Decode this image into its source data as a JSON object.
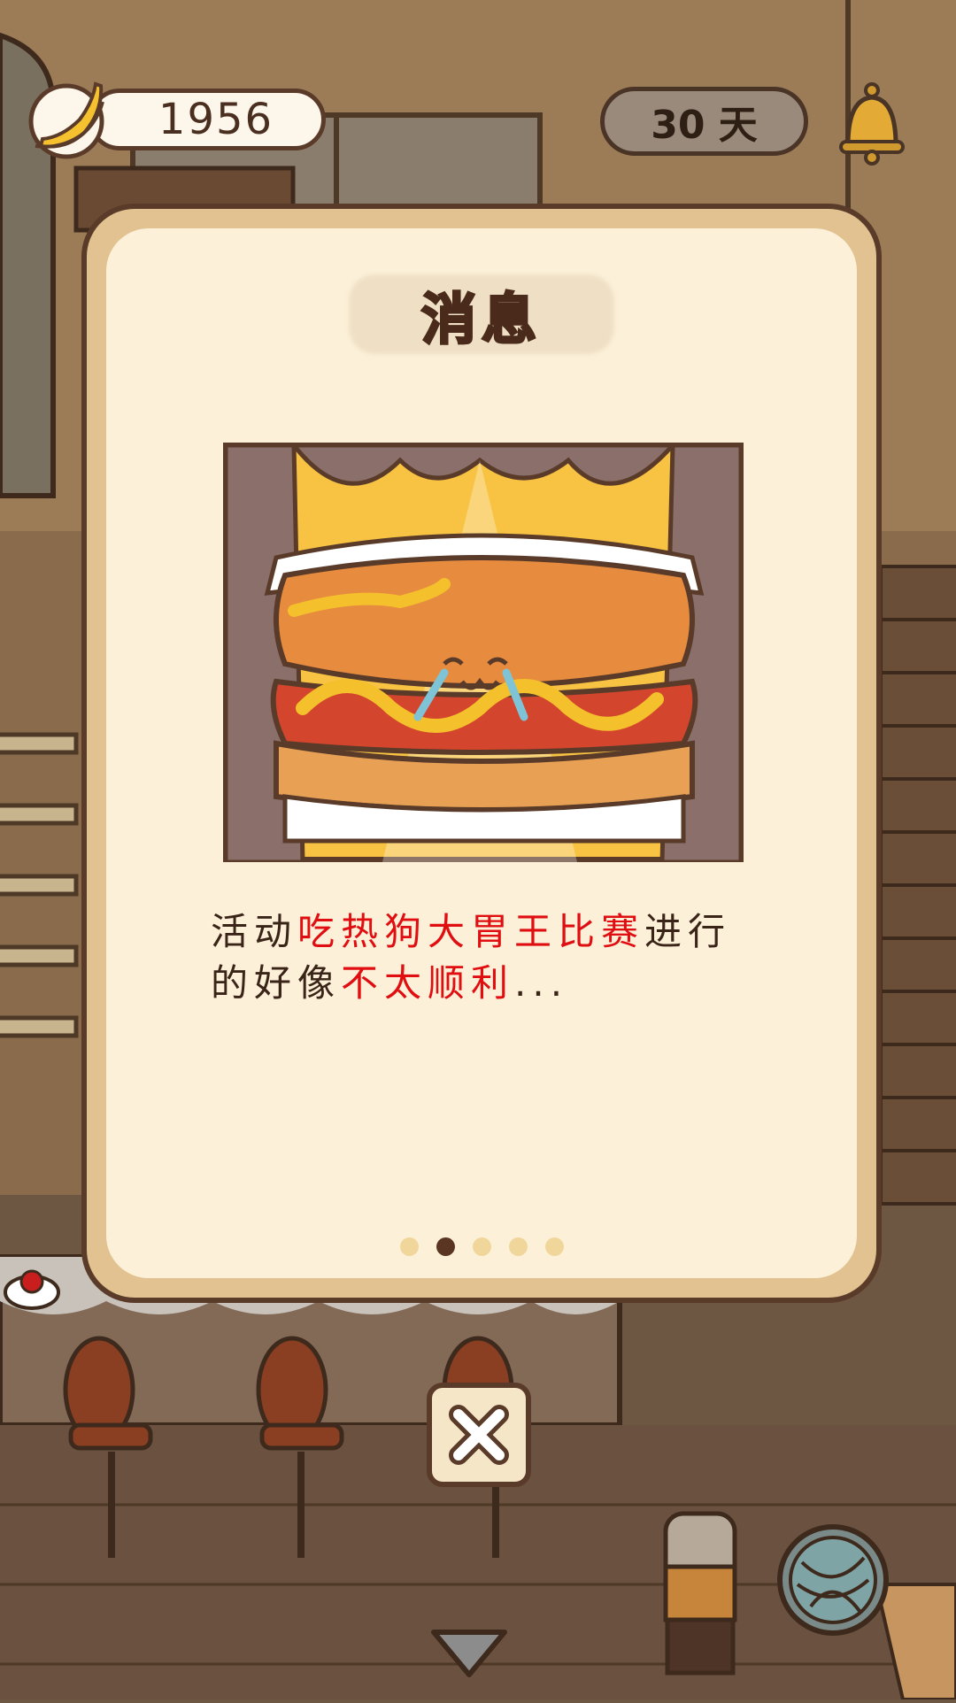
{
  "hud": {
    "banana_count": "1956",
    "day_label": "30 天",
    "banana_icon": "banana-icon",
    "bell_icon": "bell-icon"
  },
  "dialog": {
    "title": "消息",
    "message": {
      "part1": "活动",
      "highlight1": "吃热狗大胃王比赛",
      "part2": "进行的好像",
      "highlight2": "不太顺利",
      "part3": "..."
    },
    "pagination": {
      "total": 5,
      "active_index": 1
    },
    "close_icon": "close-icon"
  },
  "colors": {
    "highlight": "#e00e10",
    "dialog_border": "#e1c290",
    "dialog_bg": "#fcf0d9",
    "dot_active": "#5a3522",
    "dot_inactive": "#f0d69a"
  }
}
